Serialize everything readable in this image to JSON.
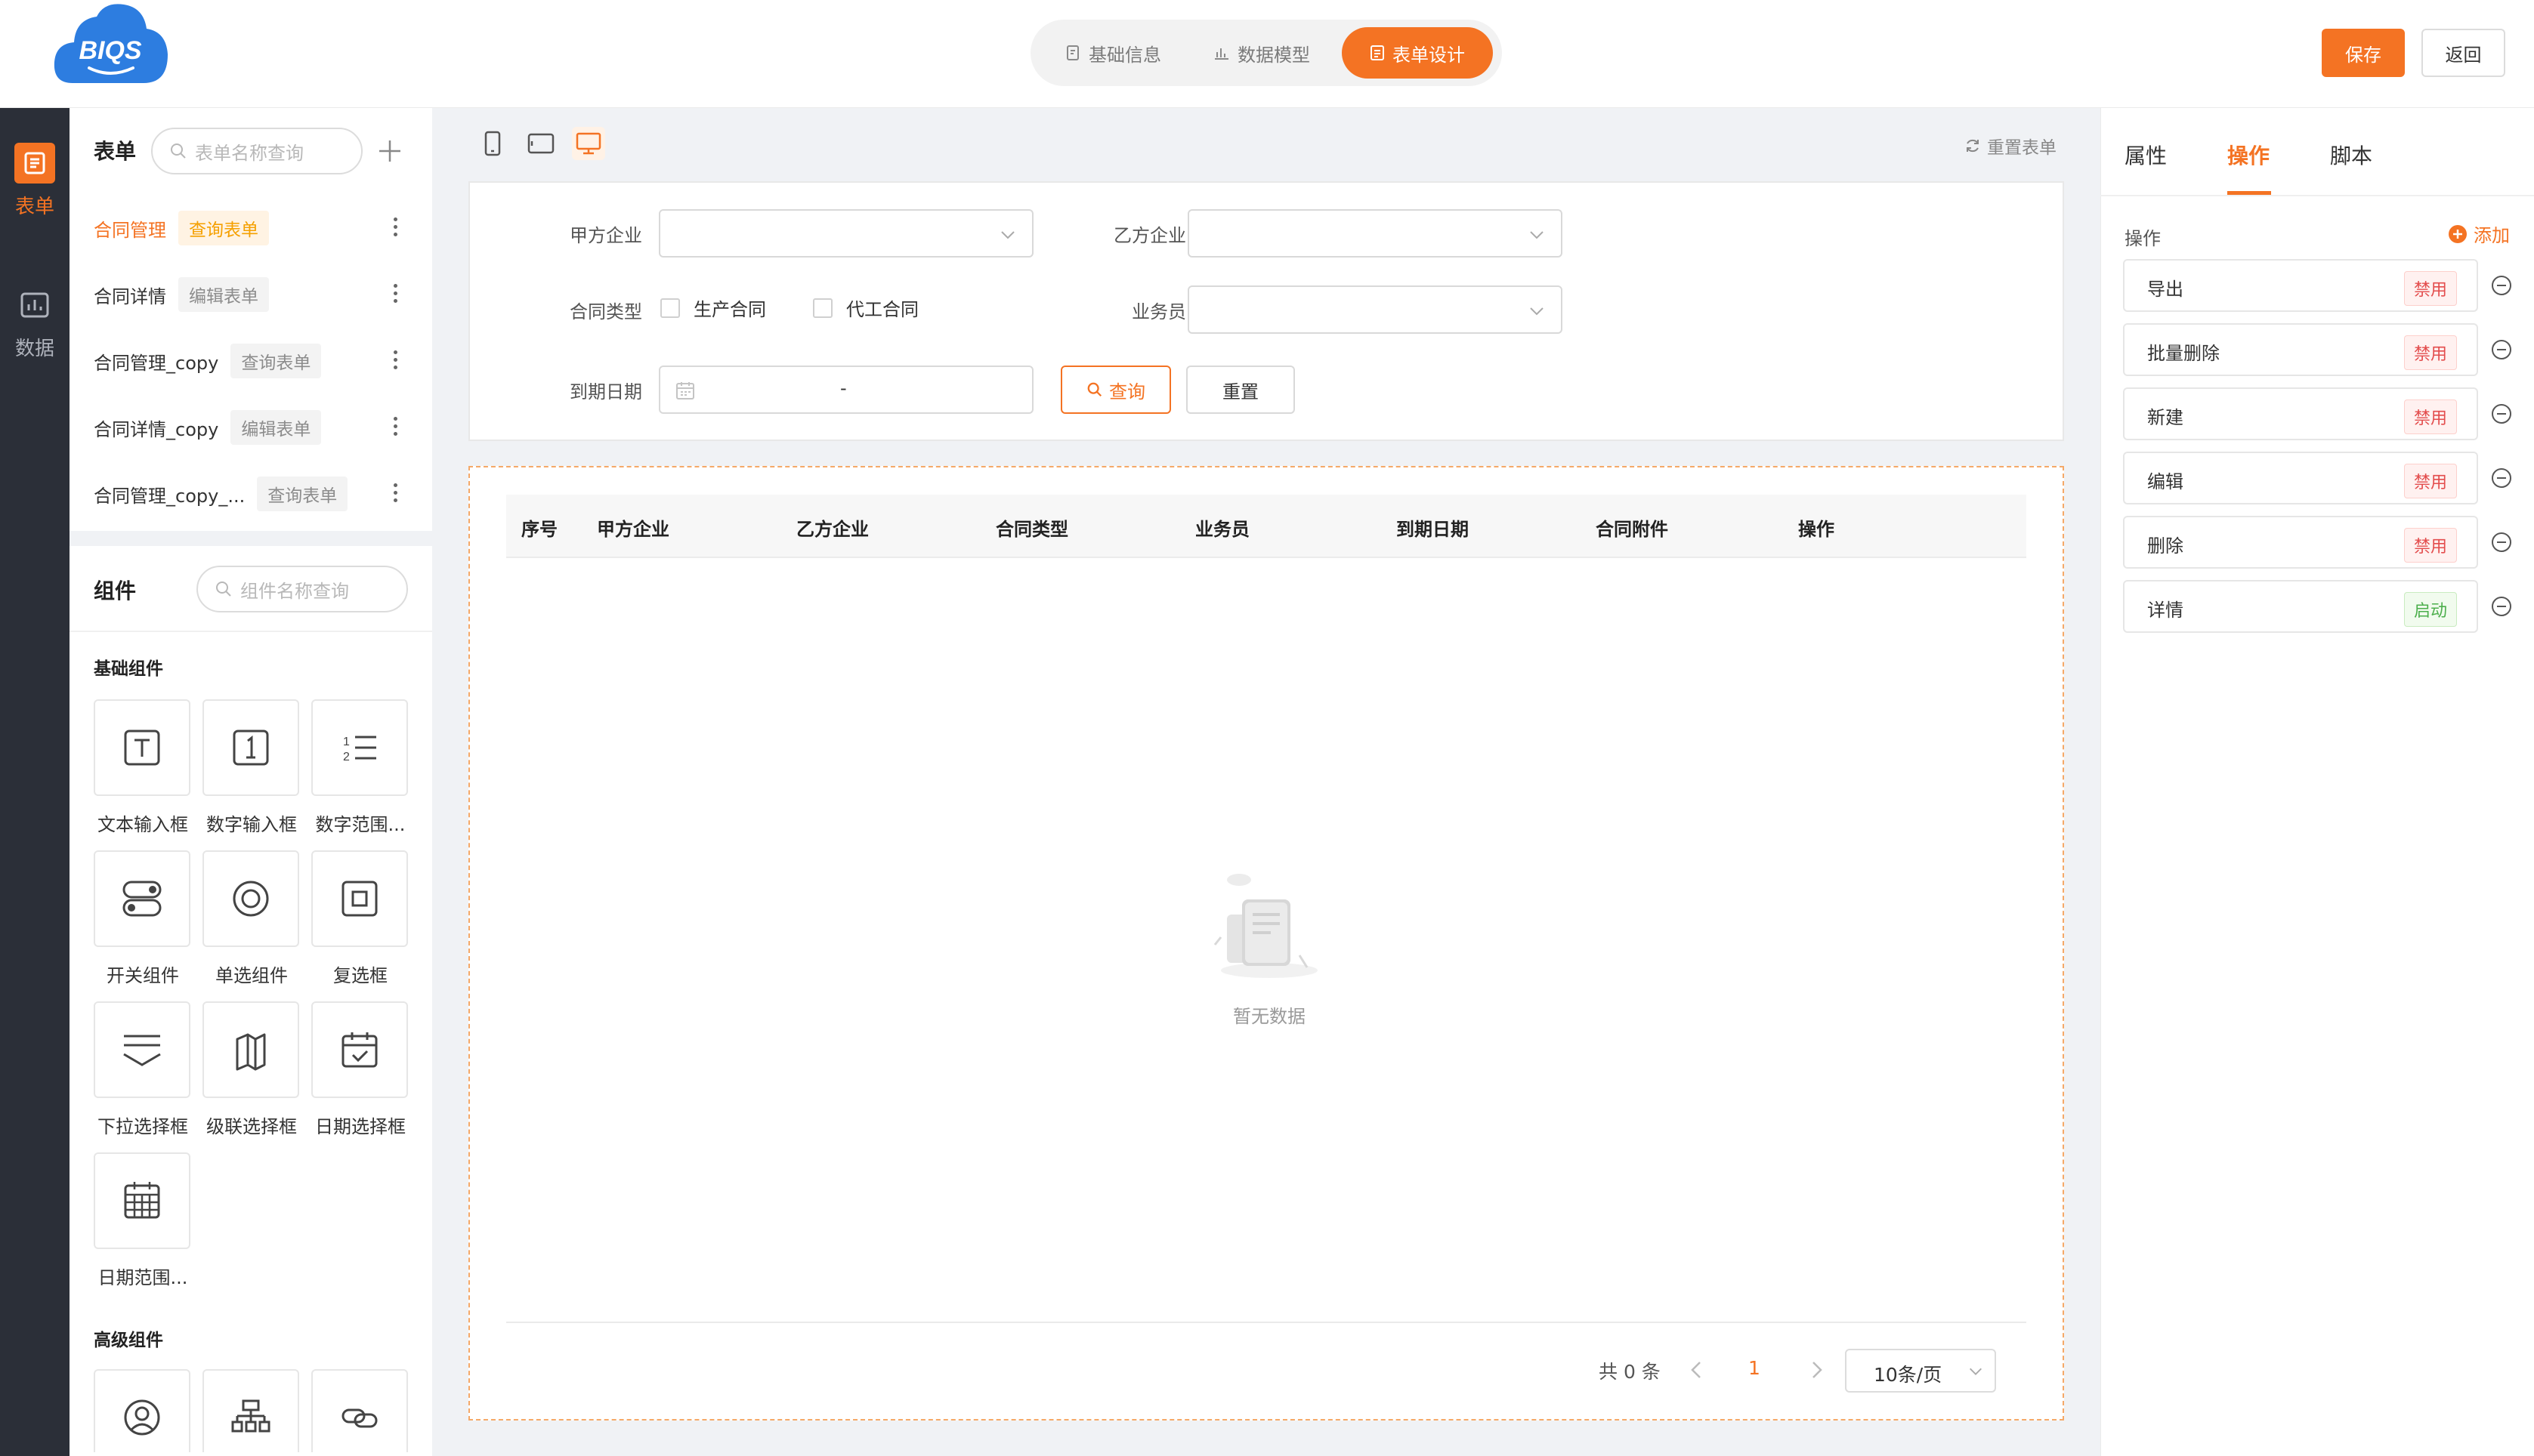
{
  "header": {
    "logo_text": "BIQS",
    "steps": [
      {
        "label": "基础信息",
        "icon": "document-edit-icon",
        "active": false
      },
      {
        "label": "数据模型",
        "icon": "bar-chart-icon",
        "active": false
      },
      {
        "label": "表单设计",
        "icon": "form-icon",
        "active": true
      }
    ],
    "save_label": "保存",
    "back_label": "返回"
  },
  "rail": {
    "items": [
      {
        "label": "表单",
        "icon": "form-icon",
        "active": true
      },
      {
        "label": "数据",
        "icon": "bar-chart-icon",
        "active": false
      }
    ]
  },
  "forms": {
    "title": "表单",
    "search_placeholder": "表单名称查询",
    "items": [
      {
        "name": "合同管理",
        "tag": "查询表单",
        "active": true
      },
      {
        "name": "合同详情",
        "tag": "编辑表单",
        "active": false
      },
      {
        "name": "合同管理_copy",
        "tag": "查询表单",
        "active": false
      },
      {
        "name": "合同详情_copy",
        "tag": "编辑表单",
        "active": false
      },
      {
        "name": "合同管理_copy_...",
        "tag": "查询表单",
        "active": false
      }
    ]
  },
  "components": {
    "title": "组件",
    "search_placeholder": "组件名称查询",
    "basic_label": "基础组件",
    "basic": [
      {
        "label": "文本输入框",
        "icon": "text-input-icon"
      },
      {
        "label": "数字输入框",
        "icon": "number-input-icon"
      },
      {
        "label": "数字范围...",
        "icon": "number-range-icon"
      },
      {
        "label": "开关组件",
        "icon": "switch-icon"
      },
      {
        "label": "单选组件",
        "icon": "radio-icon"
      },
      {
        "label": "复选框",
        "icon": "checkbox-icon"
      },
      {
        "label": "下拉选择框",
        "icon": "dropdown-icon"
      },
      {
        "label": "级联选择框",
        "icon": "cascader-icon"
      },
      {
        "label": "日期选择框",
        "icon": "date-picker-icon"
      },
      {
        "label": "日期范围...",
        "icon": "date-range-icon"
      }
    ],
    "advanced_label": "高级组件",
    "advanced": [
      {
        "label": "",
        "icon": "user-select-icon"
      },
      {
        "label": "",
        "icon": "org-tree-icon"
      },
      {
        "label": "",
        "icon": "link-icon"
      }
    ]
  },
  "canvas": {
    "devices": [
      "mobile-icon",
      "tablet-icon",
      "desktop-icon"
    ],
    "active_device": "desktop-icon",
    "reset_label": "重置表单",
    "filters": {
      "party_a_label": "甲方企业",
      "party_b_label": "乙方企业",
      "contract_type_label": "合同类型",
      "contract_types": [
        "生产合同",
        "代工合同"
      ],
      "salesman_label": "业务员",
      "due_date_label": "到期日期",
      "date_separator": "-",
      "query_label": "查询",
      "reset_label": "重置"
    },
    "table": {
      "columns": [
        "序号",
        "甲方企业",
        "乙方企业",
        "合同类型",
        "业务员",
        "到期日期",
        "合同附件",
        "操作"
      ],
      "rows": [],
      "empty_text": "暂无数据"
    },
    "pagination": {
      "total_text": "共 0 条",
      "current_page": "1",
      "page_size": "10条/页"
    }
  },
  "right_panel": {
    "tabs": [
      {
        "label": "属性",
        "active": false
      },
      {
        "label": "操作",
        "active": true
      },
      {
        "label": "脚本",
        "active": false
      }
    ],
    "section_label": "操作",
    "add_label": "添加",
    "operations": [
      {
        "name": "导出",
        "status": "禁用"
      },
      {
        "name": "批量删除",
        "status": "禁用"
      },
      {
        "name": "新建",
        "status": "禁用"
      },
      {
        "name": "编辑",
        "status": "禁用"
      },
      {
        "name": "删除",
        "status": "禁用"
      },
      {
        "name": "详情",
        "status": "启动"
      }
    ]
  },
  "colors": {
    "accent": "#f47323",
    "rail_bg": "#2b2f38",
    "disabled_tag": "#e34d4d",
    "enabled_tag": "#4caf4c",
    "logo_blue": "#2d7de0"
  }
}
